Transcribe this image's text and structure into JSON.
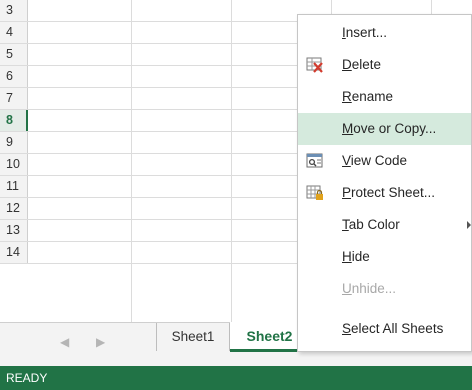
{
  "grid": {
    "rows": [
      {
        "n": "3"
      },
      {
        "n": "4"
      },
      {
        "n": "5"
      },
      {
        "n": "6"
      },
      {
        "n": "7"
      },
      {
        "n": "8"
      },
      {
        "n": "9"
      },
      {
        "n": "10"
      },
      {
        "n": "11"
      },
      {
        "n": "12"
      },
      {
        "n": "13"
      },
      {
        "n": "14"
      }
    ],
    "selected_row": "8"
  },
  "context_menu": {
    "items": [
      {
        "pre": "",
        "key": "I",
        "post": "nsert...",
        "icon": "none"
      },
      {
        "pre": "",
        "key": "D",
        "post": "elete",
        "icon": "delete-sheet-icon"
      },
      {
        "pre": "",
        "key": "R",
        "post": "ename",
        "icon": "none"
      },
      {
        "pre": "",
        "key": "M",
        "post": "ove or Copy...",
        "icon": "none",
        "state": "hover"
      },
      {
        "pre": "",
        "key": "V",
        "post": "iew Code",
        "icon": "view-code-icon"
      },
      {
        "pre": "",
        "key": "P",
        "post": "rotect Sheet...",
        "icon": "protect-sheet-icon"
      },
      {
        "pre": "",
        "key": "T",
        "post": "ab Color",
        "icon": "none",
        "submenu": true
      },
      {
        "pre": "",
        "key": "H",
        "post": "ide",
        "icon": "none"
      },
      {
        "pre": "",
        "key": "U",
        "post": "nhide...",
        "icon": "none",
        "state": "disabled"
      },
      {
        "pre": "",
        "key": "S",
        "post": "elect All Sheets",
        "icon": "none"
      }
    ]
  },
  "tabs": {
    "sheet1": "Sheet1",
    "sheet2": "Sheet2",
    "nav_prev": "◀",
    "nav_next": "▶",
    "add": "+"
  },
  "status": {
    "text": "READY"
  },
  "colors": {
    "accent": "#217346",
    "hover": "#d5eadd",
    "disabled": "#a8a8a8"
  }
}
